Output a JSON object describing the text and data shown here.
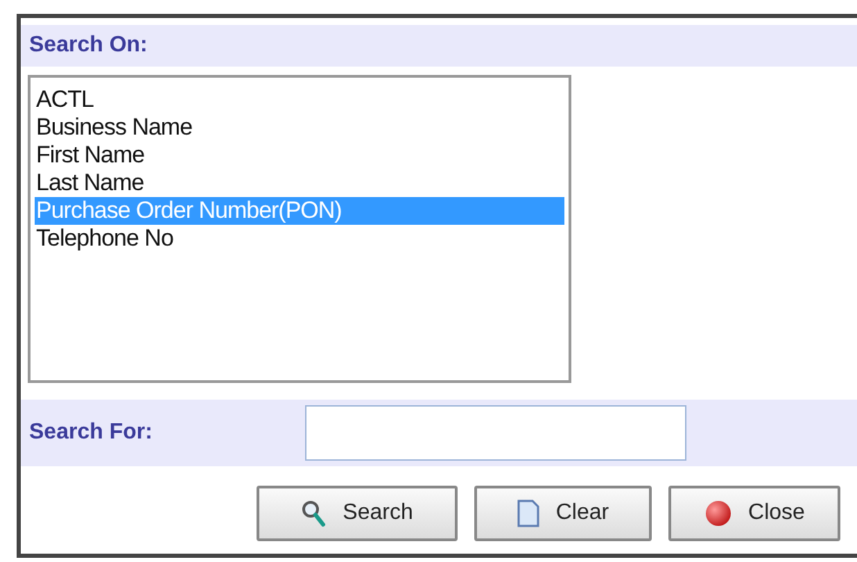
{
  "search_on": {
    "label": "Search On:",
    "options": [
      {
        "label": "ACTL",
        "selected": false
      },
      {
        "label": "Business Name",
        "selected": false
      },
      {
        "label": "First Name",
        "selected": false
      },
      {
        "label": "Last Name",
        "selected": false
      },
      {
        "label": "Purchase Order Number(PON)",
        "selected": true
      },
      {
        "label": "Telephone No",
        "selected": false
      }
    ]
  },
  "search_for": {
    "label": "Search For:"
  },
  "buttons": [
    {
      "kind": "search",
      "label": "Search"
    },
    {
      "kind": "clear",
      "label": "Clear"
    },
    {
      "kind": "close",
      "label": "Close"
    }
  ]
}
